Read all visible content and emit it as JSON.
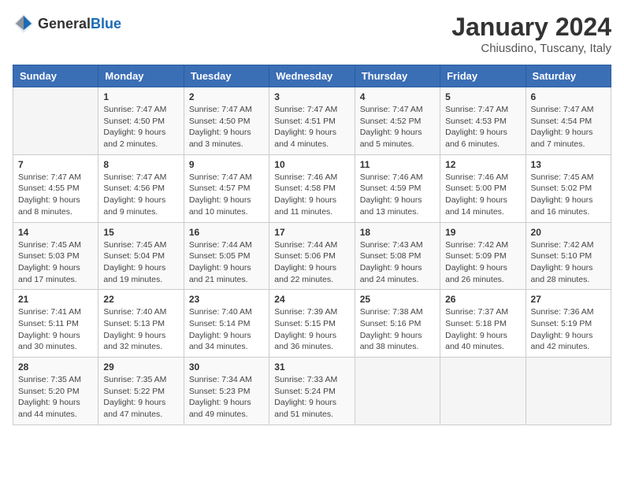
{
  "header": {
    "logo_general": "General",
    "logo_blue": "Blue",
    "title": "January 2024",
    "subtitle": "Chiusdino, Tuscany, Italy"
  },
  "weekdays": [
    "Sunday",
    "Monday",
    "Tuesday",
    "Wednesday",
    "Thursday",
    "Friday",
    "Saturday"
  ],
  "weeks": [
    [
      {
        "day": "",
        "info": ""
      },
      {
        "day": "1",
        "info": "Sunrise: 7:47 AM\nSunset: 4:50 PM\nDaylight: 9 hours\nand 2 minutes."
      },
      {
        "day": "2",
        "info": "Sunrise: 7:47 AM\nSunset: 4:50 PM\nDaylight: 9 hours\nand 3 minutes."
      },
      {
        "day": "3",
        "info": "Sunrise: 7:47 AM\nSunset: 4:51 PM\nDaylight: 9 hours\nand 4 minutes."
      },
      {
        "day": "4",
        "info": "Sunrise: 7:47 AM\nSunset: 4:52 PM\nDaylight: 9 hours\nand 5 minutes."
      },
      {
        "day": "5",
        "info": "Sunrise: 7:47 AM\nSunset: 4:53 PM\nDaylight: 9 hours\nand 6 minutes."
      },
      {
        "day": "6",
        "info": "Sunrise: 7:47 AM\nSunset: 4:54 PM\nDaylight: 9 hours\nand 7 minutes."
      }
    ],
    [
      {
        "day": "7",
        "info": "Sunrise: 7:47 AM\nSunset: 4:55 PM\nDaylight: 9 hours\nand 8 minutes."
      },
      {
        "day": "8",
        "info": "Sunrise: 7:47 AM\nSunset: 4:56 PM\nDaylight: 9 hours\nand 9 minutes."
      },
      {
        "day": "9",
        "info": "Sunrise: 7:47 AM\nSunset: 4:57 PM\nDaylight: 9 hours\nand 10 minutes."
      },
      {
        "day": "10",
        "info": "Sunrise: 7:46 AM\nSunset: 4:58 PM\nDaylight: 9 hours\nand 11 minutes."
      },
      {
        "day": "11",
        "info": "Sunrise: 7:46 AM\nSunset: 4:59 PM\nDaylight: 9 hours\nand 13 minutes."
      },
      {
        "day": "12",
        "info": "Sunrise: 7:46 AM\nSunset: 5:00 PM\nDaylight: 9 hours\nand 14 minutes."
      },
      {
        "day": "13",
        "info": "Sunrise: 7:45 AM\nSunset: 5:02 PM\nDaylight: 9 hours\nand 16 minutes."
      }
    ],
    [
      {
        "day": "14",
        "info": "Sunrise: 7:45 AM\nSunset: 5:03 PM\nDaylight: 9 hours\nand 17 minutes."
      },
      {
        "day": "15",
        "info": "Sunrise: 7:45 AM\nSunset: 5:04 PM\nDaylight: 9 hours\nand 19 minutes."
      },
      {
        "day": "16",
        "info": "Sunrise: 7:44 AM\nSunset: 5:05 PM\nDaylight: 9 hours\nand 21 minutes."
      },
      {
        "day": "17",
        "info": "Sunrise: 7:44 AM\nSunset: 5:06 PM\nDaylight: 9 hours\nand 22 minutes."
      },
      {
        "day": "18",
        "info": "Sunrise: 7:43 AM\nSunset: 5:08 PM\nDaylight: 9 hours\nand 24 minutes."
      },
      {
        "day": "19",
        "info": "Sunrise: 7:42 AM\nSunset: 5:09 PM\nDaylight: 9 hours\nand 26 minutes."
      },
      {
        "day": "20",
        "info": "Sunrise: 7:42 AM\nSunset: 5:10 PM\nDaylight: 9 hours\nand 28 minutes."
      }
    ],
    [
      {
        "day": "21",
        "info": "Sunrise: 7:41 AM\nSunset: 5:11 PM\nDaylight: 9 hours\nand 30 minutes."
      },
      {
        "day": "22",
        "info": "Sunrise: 7:40 AM\nSunset: 5:13 PM\nDaylight: 9 hours\nand 32 minutes."
      },
      {
        "day": "23",
        "info": "Sunrise: 7:40 AM\nSunset: 5:14 PM\nDaylight: 9 hours\nand 34 minutes."
      },
      {
        "day": "24",
        "info": "Sunrise: 7:39 AM\nSunset: 5:15 PM\nDaylight: 9 hours\nand 36 minutes."
      },
      {
        "day": "25",
        "info": "Sunrise: 7:38 AM\nSunset: 5:16 PM\nDaylight: 9 hours\nand 38 minutes."
      },
      {
        "day": "26",
        "info": "Sunrise: 7:37 AM\nSunset: 5:18 PM\nDaylight: 9 hours\nand 40 minutes."
      },
      {
        "day": "27",
        "info": "Sunrise: 7:36 AM\nSunset: 5:19 PM\nDaylight: 9 hours\nand 42 minutes."
      }
    ],
    [
      {
        "day": "28",
        "info": "Sunrise: 7:35 AM\nSunset: 5:20 PM\nDaylight: 9 hours\nand 44 minutes."
      },
      {
        "day": "29",
        "info": "Sunrise: 7:35 AM\nSunset: 5:22 PM\nDaylight: 9 hours\nand 47 minutes."
      },
      {
        "day": "30",
        "info": "Sunrise: 7:34 AM\nSunset: 5:23 PM\nDaylight: 9 hours\nand 49 minutes."
      },
      {
        "day": "31",
        "info": "Sunrise: 7:33 AM\nSunset: 5:24 PM\nDaylight: 9 hours\nand 51 minutes."
      },
      {
        "day": "",
        "info": ""
      },
      {
        "day": "",
        "info": ""
      },
      {
        "day": "",
        "info": ""
      }
    ]
  ]
}
